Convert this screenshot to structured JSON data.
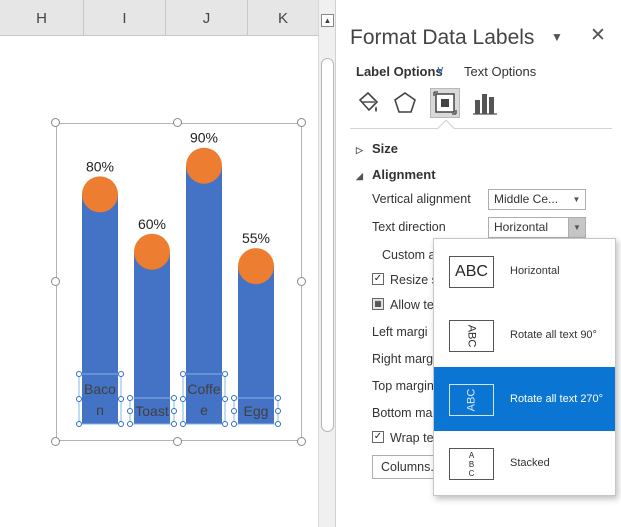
{
  "sheet": {
    "columns": [
      "H",
      "I",
      "J",
      "K"
    ]
  },
  "chart_data": {
    "type": "bar",
    "categories": [
      "Bacon",
      "Toast",
      "Coffee",
      "Egg"
    ],
    "category_label_lines": [
      [
        "Baco",
        "n"
      ],
      [
        "Toast"
      ],
      [
        "Coffe",
        "e"
      ],
      [
        "Egg"
      ]
    ],
    "values": [
      80,
      60,
      90,
      55
    ],
    "value_labels": [
      "80%",
      "60%",
      "90%",
      "55%"
    ],
    "ylim": [
      0,
      100
    ],
    "bar_color": "#4472c4",
    "marker_color": "#ed7d31",
    "grid": false,
    "legend": "none"
  },
  "pane": {
    "title": "Format Data Labels",
    "dropdown_glyph": "▼",
    "close_glyph": "✕",
    "tabs": {
      "label_options": "Label Options",
      "text_options": "Text Options"
    },
    "icons": [
      "fill-line-icon",
      "effects-icon",
      "size-properties-icon",
      "label-options-icon"
    ],
    "sections": {
      "size": "Size",
      "alignment": "Alignment"
    },
    "vertical_alignment": {
      "label": "Vertical alignment",
      "value": "Middle Ce..."
    },
    "text_direction": {
      "label": "Text direction",
      "value": "Horizontal"
    },
    "custom_angle": "Custom a",
    "resize_shape": "Resize sh",
    "allow_text": "Allow te",
    "margins": {
      "left": "Left margi",
      "right": "Right margi",
      "top": "Top margin",
      "bottom": "Bottom ma"
    },
    "wrap_text": "Wrap tex",
    "columns_button": "Columns..."
  },
  "flyout": {
    "items": [
      {
        "label": "Horizontal",
        "sample": "ABC",
        "selected": false
      },
      {
        "label": "Rotate all text 90°",
        "sample": "ABC",
        "selected": false
      },
      {
        "label": "Rotate all text 270°",
        "sample": "ABC",
        "selected": true
      },
      {
        "label": "Stacked",
        "sample": "ABC",
        "selected": false
      }
    ]
  },
  "colors": {
    "accent": "#0a75d3",
    "header_gray": "#e6e6e6"
  }
}
